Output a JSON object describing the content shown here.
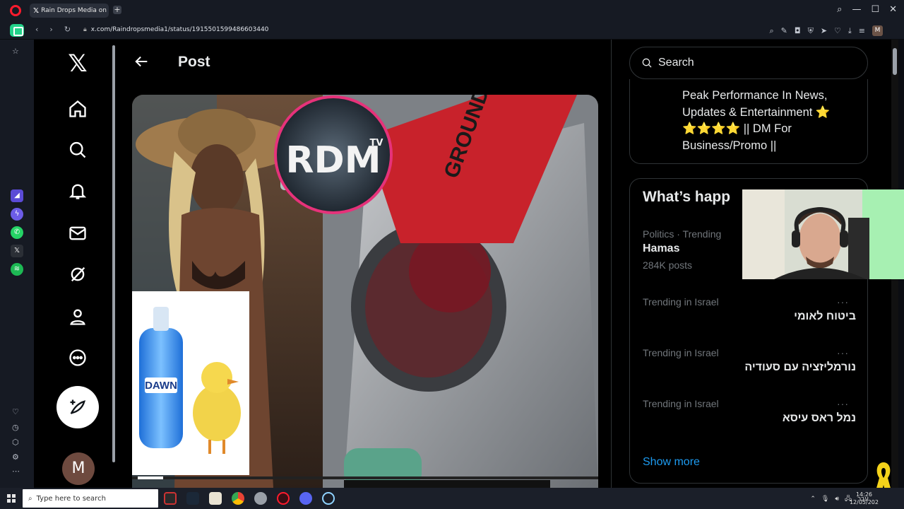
{
  "browser": {
    "tab_title": "Rain Drops Media on X:",
    "url": "x.com/Raindropsmedia1/status/1915501599486603440",
    "new_tab_symbol": "+"
  },
  "x": {
    "logo": "𝕏",
    "post_title": "Post",
    "avatar_letter": "M"
  },
  "media": {
    "logo_text": "RDM",
    "logo_sup": "TV",
    "product_label": "DAWN",
    "bag_text": "GROUND"
  },
  "sidebar": {
    "search_placeholder": "Search",
    "bio": "Peak Performance In News, Updates & Entertainment ⭐ ⭐⭐⭐⭐ || DM For Business/Promo ||",
    "trends_title": "What’s happ",
    "trends": [
      {
        "context": "Politics · Trending",
        "name": "Hamas",
        "count": "284K posts"
      },
      {
        "context": "Trending in Israel",
        "name": "ביטוח לאומי"
      },
      {
        "context": "Trending in Israel",
        "name": "נורמליזציה עם סעודיה"
      },
      {
        "context": "Trending in Israel",
        "name": "נמל ראס עיסא"
      }
    ],
    "more_dots": "···",
    "show_more": "Show more"
  },
  "taskbar": {
    "search_placeholder": "Type here to search",
    "lang": "עבר",
    "time": "14:26",
    "date": "12/05/202"
  },
  "colors": {
    "accent": "#1d9bf0",
    "opera_red": "#ff1b2d",
    "brand_green": "#23d28a"
  }
}
